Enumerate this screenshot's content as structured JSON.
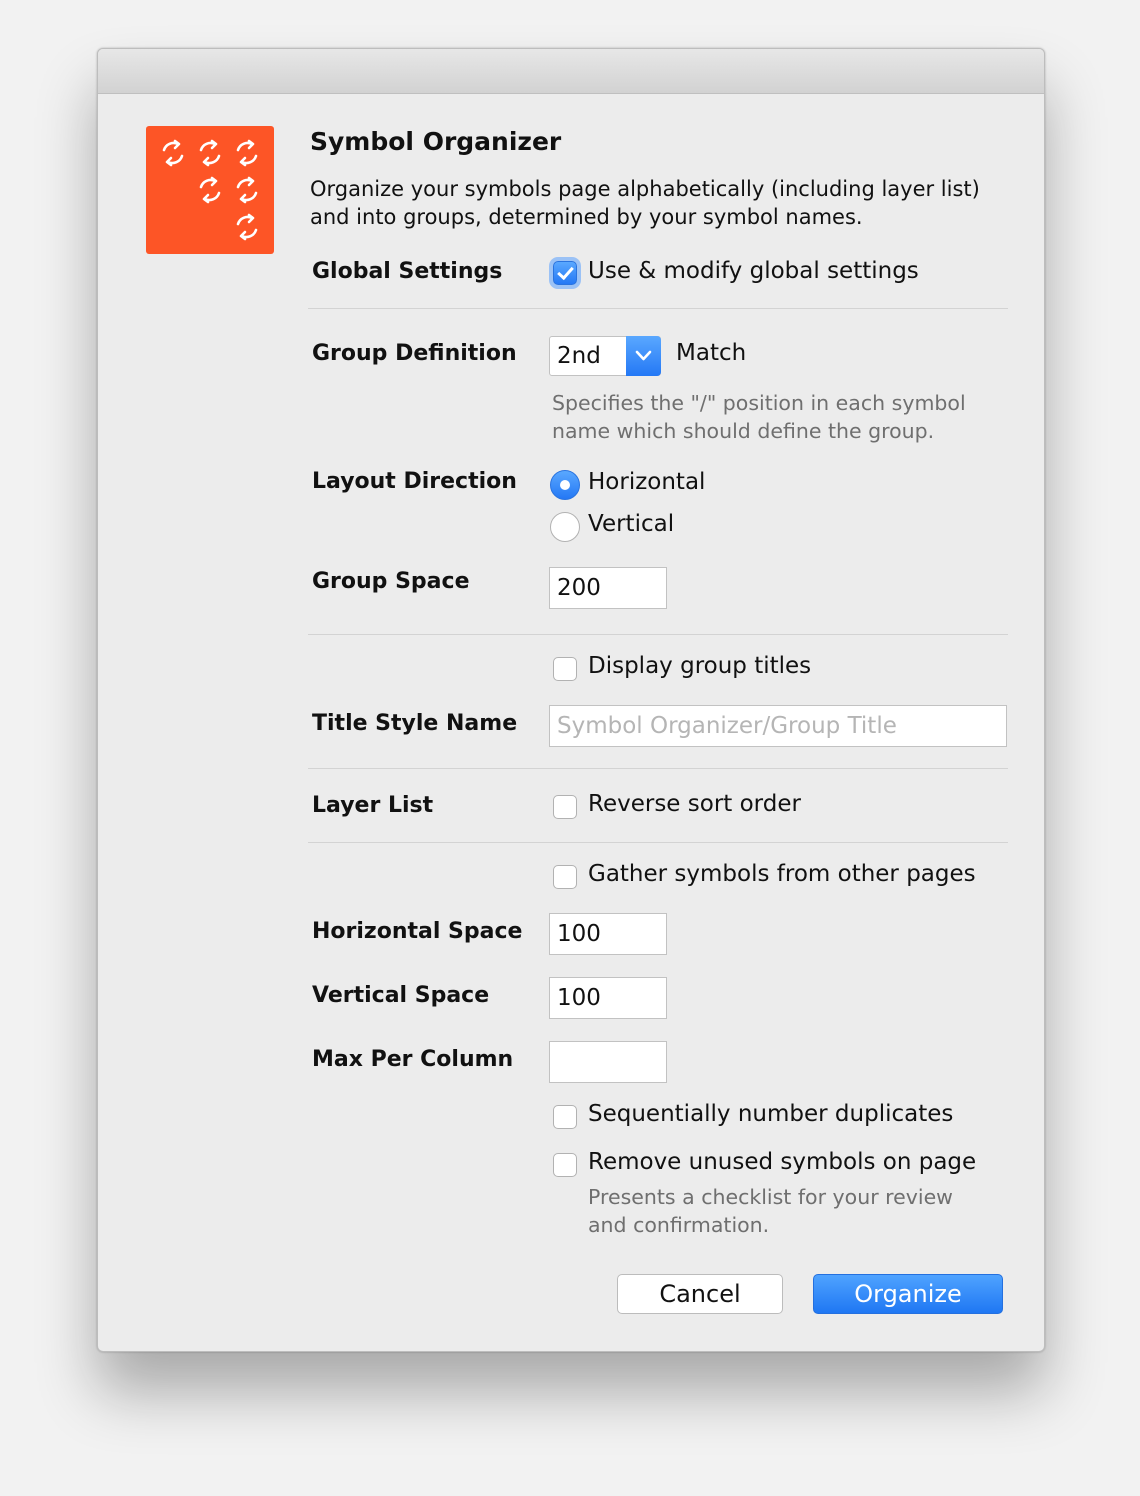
{
  "app": {
    "title": "Symbol Organizer",
    "description_line1": "Organize your symbols page alphabetically (including layer list)",
    "description_line2": "and into groups, determined by your symbol names.",
    "icon": "sync-arrows-icon",
    "icon_color": "#fd5526"
  },
  "global_settings": {
    "label": "Global Settings",
    "checkbox_label": "Use & modify global settings",
    "checked": true
  },
  "group_definition": {
    "label": "Group Definition",
    "selected": "2nd",
    "suffix": "Match",
    "hint_line1": "Specifies the \"/\" position in each symbol",
    "hint_line2": "name which should define the group."
  },
  "layout_direction": {
    "label": "Layout Direction",
    "options": [
      "Horizontal",
      "Vertical"
    ],
    "selected": "Horizontal"
  },
  "group_space": {
    "label": "Group Space",
    "value": "200"
  },
  "display_titles": {
    "label": "Display group titles",
    "checked": false
  },
  "title_style": {
    "label": "Title Style Name",
    "placeholder": "Symbol Organizer/Group Title"
  },
  "layer_list": {
    "label": "Layer List",
    "checkbox_label": "Reverse sort order",
    "checked": false
  },
  "gather": {
    "label": "Gather symbols from other pages",
    "checked": false
  },
  "horizontal_space": {
    "label": "Horizontal Space",
    "value": "100"
  },
  "vertical_space": {
    "label": "Vertical Space",
    "value": "100"
  },
  "max_per_column": {
    "label": "Max Per Column",
    "value": ""
  },
  "sequential": {
    "label": "Sequentially number duplicates",
    "checked": false
  },
  "remove_unused": {
    "label": "Remove unused symbols on page",
    "checked": false,
    "hint_line1": "Presents a checklist for your review",
    "hint_line2": "and confirmation."
  },
  "buttons": {
    "cancel": "Cancel",
    "ok": "Organize"
  },
  "colors": {
    "accent": "#2478f5",
    "dialog_bg": "#ececec"
  }
}
